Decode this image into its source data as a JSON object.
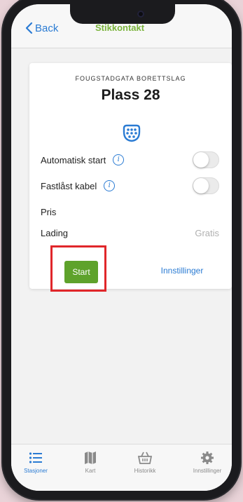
{
  "nav": {
    "back_label": "Back",
    "title": "Stikkontakt"
  },
  "station": {
    "organization": "FOUGSTADGATA BORETTSLAG",
    "place": "Plass 28",
    "connector_icon": "type2-connector-icon"
  },
  "options": {
    "auto_start_label": "Automatisk start",
    "auto_start_on": false,
    "locked_cable_label": "Fastlåst kabel",
    "locked_cable_on": false
  },
  "pricing": {
    "price_label": "Pris",
    "charging_label": "Lading",
    "charging_value": "Gratis"
  },
  "actions": {
    "start_label": "Start",
    "settings_label": "Innstillinger"
  },
  "tabs": [
    {
      "label": "Stasjoner",
      "icon": "list-icon",
      "active": true
    },
    {
      "label": "Kart",
      "icon": "map-icon",
      "active": false
    },
    {
      "label": "Historikk",
      "icon": "basket-icon",
      "active": false
    },
    {
      "label": "Innstillinger",
      "icon": "gear-icon",
      "active": false
    }
  ],
  "colors": {
    "accent": "#2a7bd3",
    "start_button": "#5ea22b",
    "highlight": "#e0262a"
  }
}
